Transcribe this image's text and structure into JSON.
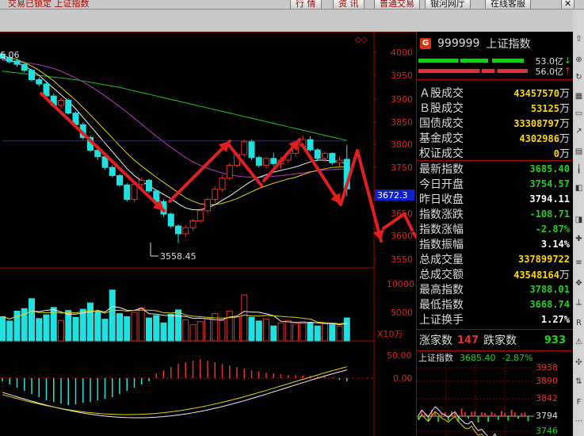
{
  "topbar": {
    "crumb": "交易已锁定  上证指数",
    "buttons": [
      "行 情",
      "资 讯",
      "普通交易",
      "银河网厅",
      "在线客服"
    ]
  },
  "colors": {
    "up": "#e03030",
    "down": "#20d020",
    "accent": "#d31"
  },
  "price_axis": [
    "4000",
    "3950",
    "3900",
    "3850",
    "3800",
    "3750",
    "3672.3",
    "3650",
    "3600",
    "3550"
  ],
  "volume_axis": [
    "10000",
    "5000",
    "X10万"
  ],
  "macd_axis": [
    "50.00",
    "0.00"
  ],
  "annotations": {
    "high": "6.06",
    "low": "3558.45"
  },
  "panel": {
    "code": "999999",
    "name": "上证指数",
    "bar_up_val": "53.0亿",
    "bar_dn_val": "56.0亿",
    "volume_rows": [
      {
        "k": "Ａ股成交",
        "v": "43457570",
        "u": "万",
        "c": "ye"
      },
      {
        "k": "Ｂ股成交",
        "v": "53125",
        "u": "万",
        "c": "ye"
      },
      {
        "k": "国债成交",
        "v": "33308797",
        "u": "万",
        "c": "ye"
      },
      {
        "k": "基金成交",
        "v": "4302986",
        "u": "万",
        "c": "ye"
      },
      {
        "k": "权证成交",
        "v": "0",
        "u": "万",
        "c": "ye"
      }
    ],
    "index_rows": [
      {
        "k": "最新指数",
        "v": "3685.40",
        "c": "dn"
      },
      {
        "k": "今日开盘",
        "v": "3754.57",
        "c": "dn"
      },
      {
        "k": "昨日收盘",
        "v": "3794.11",
        "c": "wh"
      },
      {
        "k": "指数涨跌",
        "v": "-108.71",
        "c": "dn"
      },
      {
        "k": "指数涨幅",
        "v": "-2.87%",
        "c": "dn"
      },
      {
        "k": "指数振幅",
        "v": "3.14%",
        "c": "wh"
      },
      {
        "k": "总成交量",
        "v": "337899722",
        "c": "ye"
      },
      {
        "k": "总成交额",
        "v": "43548164",
        "u": "万",
        "c": "ye"
      },
      {
        "k": "最高指数",
        "v": "3788.01",
        "c": "dn"
      },
      {
        "k": "最低指数",
        "v": "3668.74",
        "c": "dn"
      },
      {
        "k": "上证换手",
        "v": "1.27%",
        "c": "wh"
      }
    ],
    "updown": {
      "up_label": "涨家数",
      "up_count": "147",
      "dn_label": "跌家数",
      "dn_count": "933"
    },
    "mini": {
      "title": "上证指数",
      "price": "3685.40",
      "change": "-2.87%",
      "axis": [
        "3938",
        "3890",
        "3842",
        "3794",
        "3746"
      ]
    }
  },
  "chart_data": {
    "type": "candlestick",
    "ylim": [
      3500,
      4030
    ],
    "candles": [
      [
        4000,
        4006,
        3985,
        3990
      ],
      [
        3992,
        3998,
        3978,
        3982
      ],
      [
        3984,
        3990,
        3970,
        3976
      ],
      [
        3976,
        3980,
        3958,
        3962
      ],
      [
        3962,
        3966,
        3935,
        3940
      ],
      [
        3940,
        3946,
        3925,
        3930
      ],
      [
        3930,
        3934,
        3898,
        3902
      ],
      [
        3902,
        3908,
        3875,
        3880
      ],
      [
        3880,
        3898,
        3872,
        3892
      ],
      [
        3892,
        3896,
        3858,
        3862
      ],
      [
        3862,
        3866,
        3830,
        3835
      ],
      [
        3835,
        3840,
        3800,
        3805
      ],
      [
        3805,
        3810,
        3770,
        3775
      ],
      [
        3775,
        3782,
        3752,
        3760
      ],
      [
        3760,
        3764,
        3730,
        3735
      ],
      [
        3735,
        3740,
        3712,
        3716
      ],
      [
        3716,
        3720,
        3690,
        3694
      ],
      [
        3694,
        3698,
        3655,
        3660
      ],
      [
        3660,
        3700,
        3655,
        3695
      ],
      [
        3695,
        3712,
        3688,
        3705
      ],
      [
        3705,
        3709,
        3675,
        3680
      ],
      [
        3680,
        3684,
        3650,
        3655
      ],
      [
        3655,
        3660,
        3620,
        3626
      ],
      [
        3626,
        3630,
        3592,
        3598
      ],
      [
        3598,
        3602,
        3558,
        3580
      ],
      [
        3580,
        3600,
        3572,
        3594
      ],
      [
        3594,
        3615,
        3588,
        3610
      ],
      [
        3610,
        3640,
        3605,
        3634
      ],
      [
        3634,
        3665,
        3628,
        3660
      ],
      [
        3660,
        3690,
        3652,
        3684
      ],
      [
        3684,
        3716,
        3678,
        3710
      ],
      [
        3710,
        3745,
        3705,
        3740
      ],
      [
        3740,
        3770,
        3735,
        3765
      ],
      [
        3765,
        3800,
        3760,
        3795
      ],
      [
        3795,
        3800,
        3752,
        3758
      ],
      [
        3758,
        3762,
        3735,
        3740
      ],
      [
        3740,
        3760,
        3732,
        3756
      ],
      [
        3756,
        3770,
        3738,
        3744
      ],
      [
        3744,
        3760,
        3730,
        3752
      ],
      [
        3752,
        3772,
        3745,
        3768
      ],
      [
        3768,
        3790,
        3760,
        3784
      ],
      [
        3784,
        3810,
        3778,
        3800
      ],
      [
        3800,
        3808,
        3772,
        3776
      ],
      [
        3776,
        3780,
        3750,
        3756
      ],
      [
        3756,
        3772,
        3748,
        3768
      ],
      [
        3768,
        3770,
        3740,
        3746
      ],
      [
        3746,
        3760,
        3736,
        3752
      ],
      [
        3754,
        3788,
        3668,
        3685
      ]
    ],
    "ma_white": [
      3990,
      3985,
      3980,
      3972,
      3962,
      3950,
      3935,
      3920,
      3905,
      3890,
      3872,
      3852,
      3832,
      3812,
      3792,
      3772,
      3752,
      3732,
      3716,
      3703,
      3692,
      3682,
      3672,
      3662,
      3650,
      3640,
      3636,
      3636,
      3640,
      3648,
      3658,
      3668,
      3680,
      3692,
      3703,
      3712,
      3718,
      3724,
      3728,
      3732,
      3736,
      3742,
      3748,
      3752,
      3752,
      3750,
      3748,
      3744
    ],
    "ma_yellow": [
      3995,
      3992,
      3987,
      3980,
      3972,
      3962,
      3950,
      3937,
      3922,
      3907,
      3892,
      3875,
      3858,
      3840,
      3822,
      3804,
      3786,
      3768,
      3752,
      3738,
      3725,
      3712,
      3700,
      3688,
      3676,
      3664,
      3656,
      3650,
      3648,
      3648,
      3651,
      3656,
      3662,
      3670,
      3678,
      3686,
      3692,
      3698,
      3703,
      3708,
      3712,
      3718,
      3724,
      3728,
      3732,
      3735,
      3736,
      3736
    ],
    "ma_magenta": [
      3985,
      3984,
      3982,
      3980,
      3978,
      3975,
      3971,
      3966,
      3960,
      3952,
      3944,
      3935,
      3925,
      3914,
      3902,
      3890,
      3877,
      3864,
      3850,
      3836,
      3822,
      3808,
      3795,
      3782,
      3770,
      3758,
      3748,
      3740,
      3733,
      3727,
      3722,
      3718,
      3715,
      3713,
      3712,
      3712,
      3713,
      3714,
      3716,
      3718,
      3720,
      3722,
      3725,
      3727,
      3729,
      3730,
      3731,
      3731
    ],
    "ma_green": [
      3960,
      3958,
      3956,
      3954,
      3952,
      3950,
      3948,
      3946,
      3944,
      3942,
      3940,
      3937,
      3934,
      3931,
      3928,
      3925,
      3922,
      3918,
      3914,
      3910,
      3906,
      3902,
      3898,
      3894,
      3890,
      3886,
      3882,
      3878,
      3874,
      3870,
      3866,
      3862,
      3858,
      3854,
      3850,
      3846,
      3842,
      3838,
      3834,
      3830,
      3826,
      3822,
      3818,
      3814,
      3810,
      3806,
      3802,
      3798
    ],
    "ma_blue": [
      3797,
      3797,
      3797,
      3797,
      3797,
      3797,
      3797,
      3797,
      3797,
      3797,
      3797,
      3797,
      3797,
      3797,
      3797,
      3797,
      3797,
      3797,
      3797,
      3797,
      3797,
      3797,
      3797,
      3797,
      3797,
      3797,
      3797,
      3797,
      3797,
      3797,
      3797,
      3797,
      3797,
      3797,
      3797,
      3797,
      3797,
      3797,
      3797,
      3797,
      3797,
      3797,
      3797,
      3797,
      3797,
      3797,
      3797,
      3797
    ],
    "volume": [
      3900,
      3200,
      4800,
      5200,
      6800,
      3600,
      4200,
      5400,
      3300,
      4900,
      3800,
      5100,
      6100,
      4700,
      3500,
      8200,
      4400,
      3900,
      4600,
      5300,
      3700,
      4100,
      2900,
      4300,
      5000,
      3400,
      2600,
      3100,
      3600,
      4400,
      3300,
      4800,
      3900,
      7400,
      3800,
      3200,
      3500,
      2400,
      2900,
      3300,
      2800,
      3100,
      2900,
      2400,
      2800,
      2600,
      2400,
      3700
    ],
    "macd_hist": [
      -4,
      -8,
      -12,
      -16,
      -20,
      -24,
      -28,
      -30,
      -32,
      -34,
      -33,
      -31,
      -30,
      -28,
      -26,
      -24,
      -20,
      -16,
      -12,
      -8,
      -4,
      6,
      10,
      14,
      18,
      20,
      22,
      24,
      22,
      20,
      18,
      16,
      14,
      12,
      10,
      8,
      7,
      6,
      5,
      4,
      4,
      3,
      3,
      2,
      2,
      1,
      -2,
      -4
    ],
    "arrows": [
      [
        [
          52,
          118
        ],
        [
          207,
          266
        ]
      ],
      [
        [
          214,
          254
        ],
        [
          290,
          178
        ]
      ],
      [
        [
          288,
          182
        ],
        [
          330,
          234
        ]
      ],
      [
        [
          333,
          228
        ],
        [
          378,
          176
        ]
      ],
      [
        [
          381,
          182
        ],
        [
          430,
          258
        ]
      ],
      [
        [
          430,
          258
        ],
        [
          451,
          190
        ]
      ],
      [
        [
          451,
          190
        ],
        [
          481,
          304
        ]
      ],
      [
        [
          484,
          288
        ],
        [
          510,
          270
        ]
      ],
      [
        [
          510,
          270
        ],
        [
          520,
          290
        ]
      ],
      [
        [
          522,
          294
        ],
        [
          596,
          407
        ]
      ]
    ],
    "mini_chart": {
      "price_line": [
        3794,
        3810,
        3800,
        3790,
        3806,
        3820,
        3812,
        3800,
        3795,
        3788,
        3798,
        3805,
        3790,
        3780,
        3770,
        3768,
        3776,
        3760,
        3748,
        3752,
        3740,
        3730,
        3726,
        3738,
        3720,
        3712,
        3708,
        3716,
        3704,
        3700,
        3694,
        3690,
        3686,
        3685
      ],
      "vol": [
        5,
        7,
        4,
        8,
        10,
        6,
        9,
        4,
        6,
        7,
        8,
        5,
        9,
        12,
        6,
        4,
        7,
        8,
        10,
        6,
        5,
        9,
        7,
        4,
        6,
        8,
        5,
        7,
        10,
        6,
        4,
        5,
        6,
        8
      ]
    }
  }
}
